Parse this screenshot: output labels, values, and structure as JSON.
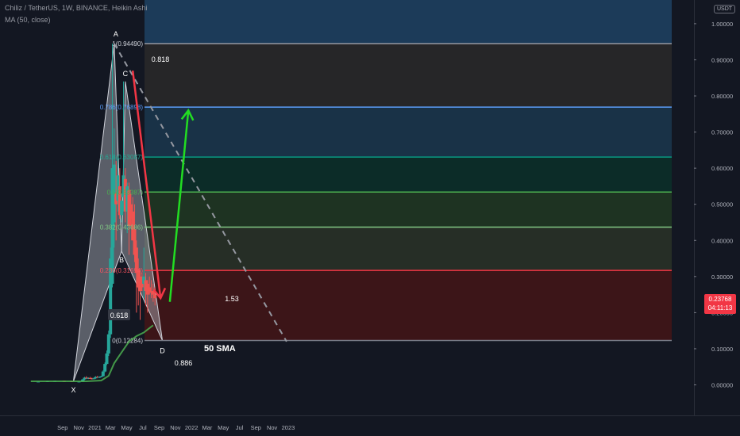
{
  "header": {
    "title": "Chiliz / TetherUS, 1W, BINANCE, Heikin Ashi",
    "indicator": "MA (50, close)",
    "currency_badge": "USDT"
  },
  "price_tag": {
    "price": "0.23768",
    "countdown": "04:11:13",
    "color": "#f23645"
  },
  "chart_data": {
    "type": "candlestick",
    "y_ticks": [
      "1.00000",
      "0.90000",
      "0.80000",
      "0.70000",
      "0.60000",
      "0.50000",
      "0.40000",
      "0.30000",
      "0.20000",
      "0.10000",
      "0.00000"
    ],
    "y_range": [
      -0.02,
      1.05
    ],
    "x_ticks": [
      "Sep",
      "Nov",
      "2021",
      "Mar",
      "May",
      "Jul",
      "Sep",
      "Nov",
      "2022",
      "Mar",
      "May",
      "Jul",
      "Sep",
      "Nov",
      "2023"
    ],
    "fib_levels": [
      {
        "label": "1(0.94490)",
        "value": 0.9449,
        "line": "#9598a1",
        "text": "#d1d4dc",
        "band": "#1c3b59"
      },
      {
        "label": "0.786(0.76898)",
        "value": 0.76898,
        "line": "#5b9cf6",
        "text": "#5b9cf6",
        "band": "#262628"
      },
      {
        "label": "0.618(0.63087)",
        "value": 0.63087,
        "line": "#089981",
        "text": "#22ab94",
        "band": "#193247"
      },
      {
        "label": "0.5(0.53387)",
        "value": 0.53387,
        "line": "#4caf50",
        "text": "#4caf50",
        "band": "#0c2c28"
      },
      {
        "label": "0.382(0.43686)",
        "value": 0.43686,
        "line": "#81c784",
        "text": "#81c784",
        "band": "#1e3322"
      },
      {
        "label": "0.236(0.31694)",
        "value": 0.31694,
        "line": "#f23645",
        "text": "#f7525f",
        "band": "#262e26"
      },
      {
        "label": "0(0.12284)",
        "value": 0.12284,
        "line": "#787b86",
        "text": "#d1d4dc",
        "band": "#3c1518"
      }
    ],
    "harmonic_points": [
      {
        "label": "X",
        "date": "2020-10-12",
        "value": 0.01
      },
      {
        "label": "A",
        "date": "2021-03-15",
        "value": 0.9449
      },
      {
        "label": "B",
        "date": "2021-04-12",
        "value": 0.37
      },
      {
        "label": "C",
        "date": "2021-04-26",
        "value": 0.84
      },
      {
        "label": "D",
        "date": "2021-09-13",
        "value": 0.12284
      }
    ],
    "ratio_labels": [
      "0.618",
      "0.818",
      "1.53",
      "0.886"
    ],
    "sma_label": "50 SMA",
    "trend_line": {
      "from": [
        "2021-03-15",
        0.9449
      ],
      "to": [
        "2022-12-26",
        0.12
      ]
    },
    "arrows": [
      {
        "direction": "down",
        "color": "#f23645",
        "from": [
          "2021-05-24",
          0.87
        ],
        "to": [
          "2021-09-06",
          0.24
        ]
      },
      {
        "direction": "up",
        "color": "#22dd22",
        "from": [
          "2021-10-11",
          0.23
        ],
        "to": [
          "2021-12-20",
          0.76
        ]
      }
    ],
    "candles": [
      {
        "date": "2020-06-01",
        "open": 0.009,
        "high": 0.01,
        "low": 0.008,
        "close": 0.009
      },
      {
        "date": "2020-07-06",
        "open": 0.009,
        "high": 0.011,
        "low": 0.008,
        "close": 0.01
      },
      {
        "date": "2020-08-03",
        "open": 0.01,
        "high": 0.012,
        "low": 0.009,
        "close": 0.011
      },
      {
        "date": "2020-09-07",
        "open": 0.011,
        "high": 0.012,
        "low": 0.009,
        "close": 0.01
      },
      {
        "date": "2020-10-05",
        "open": 0.01,
        "high": 0.011,
        "low": 0.008,
        "close": 0.009
      },
      {
        "date": "2020-11-02",
        "open": 0.009,
        "high": 0.01,
        "low": 0.008,
        "close": 0.009
      },
      {
        "date": "2020-11-16",
        "open": 0.009,
        "high": 0.016,
        "low": 0.009,
        "close": 0.015
      },
      {
        "date": "2020-11-23",
        "open": 0.015,
        "high": 0.022,
        "low": 0.013,
        "close": 0.02
      },
      {
        "date": "2020-11-30",
        "open": 0.02,
        "high": 0.024,
        "low": 0.017,
        "close": 0.018
      },
      {
        "date": "2020-12-07",
        "open": 0.018,
        "high": 0.021,
        "low": 0.016,
        "close": 0.019
      },
      {
        "date": "2020-12-14",
        "open": 0.019,
        "high": 0.022,
        "low": 0.017,
        "close": 0.018
      },
      {
        "date": "2020-12-21",
        "open": 0.018,
        "high": 0.02,
        "low": 0.015,
        "close": 0.017
      },
      {
        "date": "2020-12-28",
        "open": 0.017,
        "high": 0.02,
        "low": 0.016,
        "close": 0.018
      },
      {
        "date": "2021-01-04",
        "open": 0.018,
        "high": 0.024,
        "low": 0.017,
        "close": 0.022
      },
      {
        "date": "2021-01-11",
        "open": 0.022,
        "high": 0.025,
        "low": 0.02,
        "close": 0.021
      },
      {
        "date": "2021-01-18",
        "open": 0.021,
        "high": 0.023,
        "low": 0.019,
        "close": 0.022
      },
      {
        "date": "2021-01-25",
        "open": 0.022,
        "high": 0.025,
        "low": 0.021,
        "close": 0.024
      },
      {
        "date": "2021-02-01",
        "open": 0.024,
        "high": 0.04,
        "low": 0.023,
        "close": 0.037
      },
      {
        "date": "2021-02-08",
        "open": 0.037,
        "high": 0.062,
        "low": 0.035,
        "close": 0.058
      },
      {
        "date": "2021-02-15",
        "open": 0.058,
        "high": 0.095,
        "low": 0.055,
        "close": 0.087
      },
      {
        "date": "2021-02-22",
        "open": 0.087,
        "high": 0.15,
        "low": 0.08,
        "close": 0.14
      },
      {
        "date": "2021-03-01",
        "open": 0.14,
        "high": 0.38,
        "low": 0.13,
        "close": 0.35
      },
      {
        "date": "2021-03-08",
        "open": 0.28,
        "high": 0.9449,
        "low": 0.27,
        "close": 0.6
      },
      {
        "date": "2021-03-15",
        "open": 0.45,
        "high": 0.71,
        "low": 0.38,
        "close": 0.61
      },
      {
        "date": "2021-03-22",
        "open": 0.53,
        "high": 0.62,
        "low": 0.4,
        "close": 0.5
      },
      {
        "date": "2021-03-29",
        "open": 0.51,
        "high": 0.63,
        "low": 0.48,
        "close": 0.58
      },
      {
        "date": "2021-04-05",
        "open": 0.55,
        "high": 0.6,
        "low": 0.46,
        "close": 0.47
      },
      {
        "date": "2021-04-12",
        "open": 0.47,
        "high": 0.53,
        "low": 0.45,
        "close": 0.51
      },
      {
        "date": "2021-04-19",
        "open": 0.52,
        "high": 0.84,
        "low": 0.48,
        "close": 0.58
      },
      {
        "date": "2021-04-26",
        "open": 0.57,
        "high": 0.6,
        "low": 0.45,
        "close": 0.48
      },
      {
        "date": "2021-05-03",
        "open": 0.48,
        "high": 0.56,
        "low": 0.42,
        "close": 0.55
      },
      {
        "date": "2021-05-10",
        "open": 0.54,
        "high": 0.56,
        "low": 0.36,
        "close": 0.44
      },
      {
        "date": "2021-05-17",
        "open": 0.5,
        "high": 0.53,
        "low": 0.44,
        "close": 0.46
      },
      {
        "date": "2021-05-24",
        "open": 0.48,
        "high": 0.52,
        "low": 0.4,
        "close": 0.4
      },
      {
        "date": "2021-05-31",
        "open": 0.43,
        "high": 0.5,
        "low": 0.34,
        "close": 0.36
      },
      {
        "date": "2021-06-07",
        "open": 0.38,
        "high": 0.4,
        "low": 0.2,
        "close": 0.31
      },
      {
        "date": "2021-06-14",
        "open": 0.32,
        "high": 0.35,
        "low": 0.22,
        "close": 0.27
      },
      {
        "date": "2021-06-21",
        "open": 0.3,
        "high": 0.32,
        "low": 0.18,
        "close": 0.26
      },
      {
        "date": "2021-06-28",
        "open": 0.28,
        "high": 0.31,
        "low": 0.26,
        "close": 0.27
      },
      {
        "date": "2021-07-05",
        "open": 0.28,
        "high": 0.38,
        "low": 0.24,
        "close": 0.3
      },
      {
        "date": "2021-07-12",
        "open": 0.29,
        "high": 0.31,
        "low": 0.22,
        "close": 0.26
      },
      {
        "date": "2021-07-19",
        "open": 0.28,
        "high": 0.29,
        "low": 0.2,
        "close": 0.25
      },
      {
        "date": "2021-07-26",
        "open": 0.27,
        "high": 0.3,
        "low": 0.25,
        "close": 0.26
      },
      {
        "date": "2021-08-02",
        "open": 0.26,
        "high": 0.29,
        "low": 0.24,
        "close": 0.255
      },
      {
        "date": "2021-08-09",
        "open": 0.26,
        "high": 0.28,
        "low": 0.23,
        "close": 0.25
      },
      {
        "date": "2021-08-16",
        "open": 0.25,
        "high": 0.27,
        "low": 0.22,
        "close": 0.24
      }
    ],
    "sma": [
      {
        "date": "2020-05-04",
        "value": 0.01
      },
      {
        "date": "2020-11-30",
        "value": 0.01
      },
      {
        "date": "2021-01-25",
        "value": 0.012
      },
      {
        "date": "2021-02-22",
        "value": 0.025
      },
      {
        "date": "2021-03-15",
        "value": 0.06
      },
      {
        "date": "2021-04-12",
        "value": 0.09
      },
      {
        "date": "2021-05-10",
        "value": 0.12
      },
      {
        "date": "2021-06-07",
        "value": 0.135
      },
      {
        "date": "2021-07-05",
        "value": 0.145
      },
      {
        "date": "2021-08-09",
        "value": 0.165
      }
    ]
  }
}
